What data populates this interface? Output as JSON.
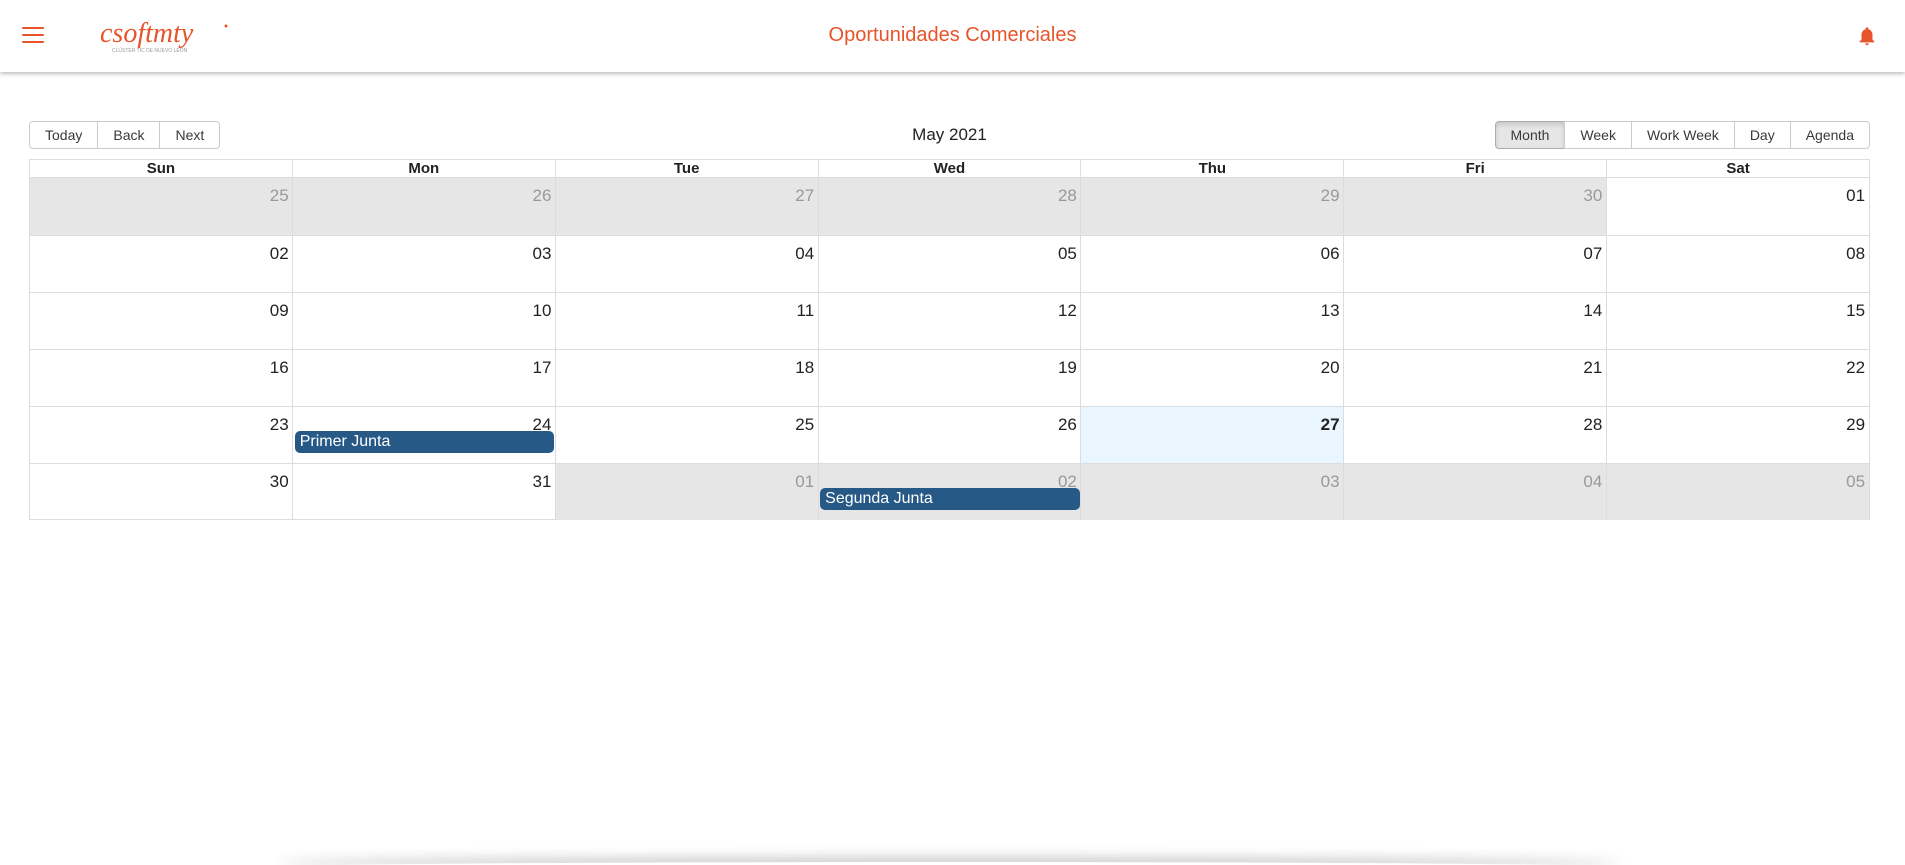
{
  "app": {
    "title": "Oportunidades Comerciales",
    "logo_text": "csoftmty",
    "logo_tagline": "CLÚSTER TIC DE NUEVO LEÓN",
    "menu_icon": "hamburger-menu-icon",
    "notification_icon": "bell-icon"
  },
  "toolbar": {
    "nav_buttons": [
      "Today",
      "Back",
      "Next"
    ],
    "label": "May 2021",
    "view_buttons": [
      "Month",
      "Week",
      "Work Week",
      "Day",
      "Agenda"
    ],
    "active_view": "Month"
  },
  "calendar": {
    "weekdays": [
      "Sun",
      "Mon",
      "Tue",
      "Wed",
      "Thu",
      "Fri",
      "Sat"
    ],
    "weeks": [
      [
        {
          "n": "25",
          "off": true
        },
        {
          "n": "26",
          "off": true
        },
        {
          "n": "27",
          "off": true
        },
        {
          "n": "28",
          "off": true
        },
        {
          "n": "29",
          "off": true
        },
        {
          "n": "30",
          "off": true
        },
        {
          "n": "01"
        }
      ],
      [
        {
          "n": "02"
        },
        {
          "n": "03"
        },
        {
          "n": "04"
        },
        {
          "n": "05"
        },
        {
          "n": "06"
        },
        {
          "n": "07"
        },
        {
          "n": "08"
        }
      ],
      [
        {
          "n": "09"
        },
        {
          "n": "10"
        },
        {
          "n": "11"
        },
        {
          "n": "12"
        },
        {
          "n": "13"
        },
        {
          "n": "14"
        },
        {
          "n": "15"
        }
      ],
      [
        {
          "n": "16"
        },
        {
          "n": "17"
        },
        {
          "n": "18"
        },
        {
          "n": "19"
        },
        {
          "n": "20"
        },
        {
          "n": "21"
        },
        {
          "n": "22"
        }
      ],
      [
        {
          "n": "23"
        },
        {
          "n": "24"
        },
        {
          "n": "25"
        },
        {
          "n": "26"
        },
        {
          "n": "27",
          "today": true
        },
        {
          "n": "28"
        },
        {
          "n": "29"
        }
      ],
      [
        {
          "n": "30"
        },
        {
          "n": "31"
        },
        {
          "n": "01",
          "off": true
        },
        {
          "n": "02",
          "off": true
        },
        {
          "n": "03",
          "off": true
        },
        {
          "n": "04",
          "off": true
        },
        {
          "n": "05",
          "off": true
        }
      ]
    ],
    "events": [
      {
        "title": "Primer Junta",
        "week": 4,
        "day": 1
      },
      {
        "title": "Segunda Junta",
        "week": 5,
        "day": 3
      }
    ]
  },
  "colors": {
    "accent": "#e8542a",
    "event": "#265985",
    "off_range": "#e6e6e6",
    "today": "#eaf6ff"
  }
}
